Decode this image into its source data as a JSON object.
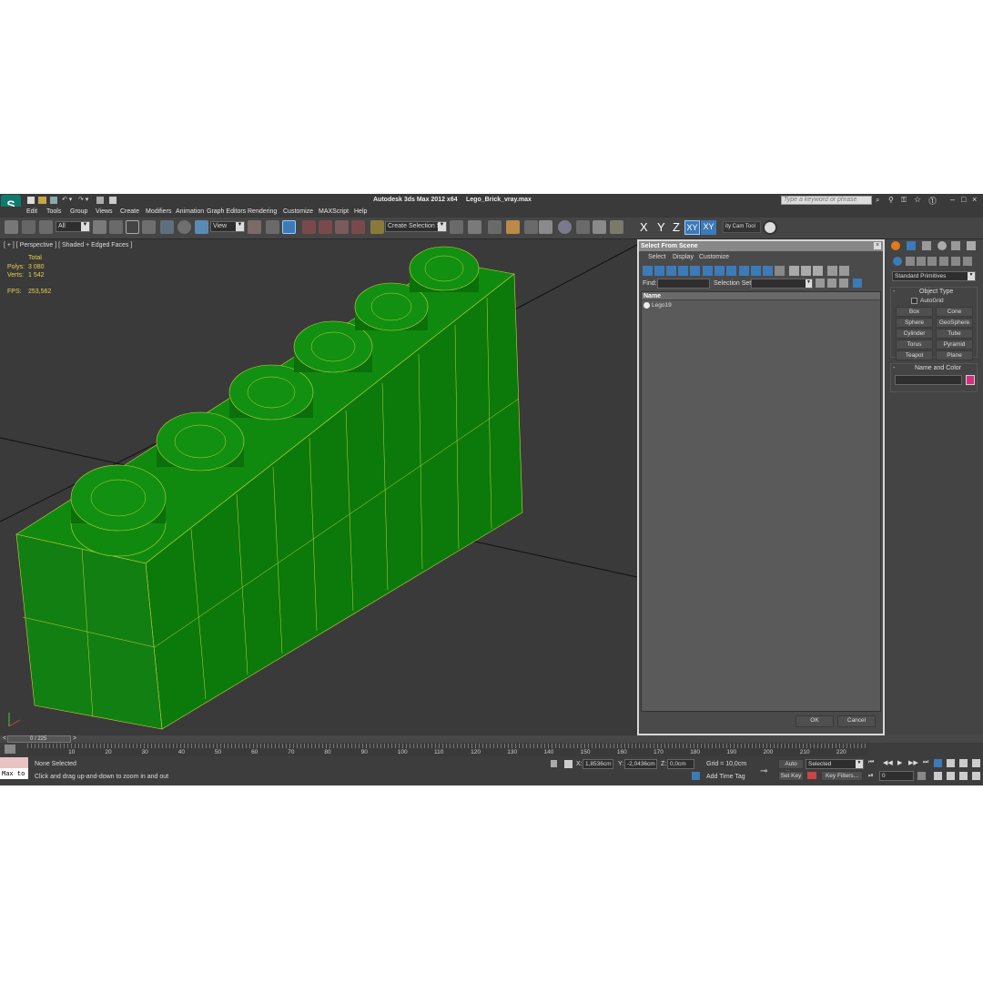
{
  "window": {
    "title": "Autodesk 3ds Max  2012 x64",
    "file": "Lego_Brick_vray.max",
    "search_placeholder": "Type a keyword or phrase",
    "logo_glyph": "S"
  },
  "menu": [
    "Edit",
    "Tools",
    "Group",
    "Views",
    "Create",
    "Modifiers",
    "Animation",
    "Graph Editors",
    "Rendering",
    "Customize",
    "MAXScript",
    "Help"
  ],
  "toolbar": {
    "filter_value": "All",
    "ref_coord_value": "View",
    "selection_set_value": "Create Selection Se",
    "axis_labels": [
      "X",
      "Y",
      "Z",
      "XY",
      "XY"
    ],
    "cam_tool_label": "ity Cam Tool"
  },
  "viewport": {
    "label": "[ + ] [ Perspective ] [ Shaded + Edged Faces ]",
    "stats": {
      "total_label": "Total",
      "polys_label": "Polys:",
      "polys_value": "3 080",
      "verts_label": "Verts:",
      "verts_value": "1 542",
      "fps_label": "FPS:",
      "fps_value": "253,562"
    },
    "object_color": "#0e8a0e"
  },
  "dialog": {
    "title": "Select From Scene",
    "menu": [
      "Select",
      "Display",
      "Customize"
    ],
    "find_label": "Find:",
    "selection_set_label": "Selection Set:",
    "column_name": "Name",
    "items": [
      "Lego19"
    ],
    "ok_label": "OK",
    "cancel_label": "Cancel"
  },
  "command_panel": {
    "category": "Standard Primitives",
    "object_type_header": "Object Type",
    "autogrid_label": "AutoGrid",
    "buttons": [
      "Box",
      "Cone",
      "Sphere",
      "GeoSphere",
      "Cylinder",
      "Tube",
      "Torus",
      "Pyramid",
      "Teapot",
      "Plane"
    ],
    "name_color_header": "Name and Color",
    "swatch_color": "#d6317e"
  },
  "timeline": {
    "frame_counter": "0 / 225",
    "ticks": [
      10,
      20,
      30,
      40,
      50,
      60,
      70,
      80,
      90,
      100,
      110,
      120,
      130,
      140,
      150,
      160,
      170,
      180,
      190,
      200,
      210,
      220
    ]
  },
  "status": {
    "maxscript_label": "Max to",
    "selection_status": "None Selected",
    "prompt": "Click and drag up-and-down to zoom in and out",
    "x_label": "X:",
    "x_value": "1,8536cm",
    "y_label": "Y:",
    "y_value": "-2,0436cm",
    "z_label": "Z:",
    "z_value": "0,0cm",
    "grid": "Grid = 10,0cm",
    "add_time_tag": "Add Time Tag",
    "auto_key": "Auto Key",
    "set_key": "Set Key",
    "key_mode_value": "Selected",
    "key_filters": "Key Filters...",
    "current_frame": "0"
  }
}
